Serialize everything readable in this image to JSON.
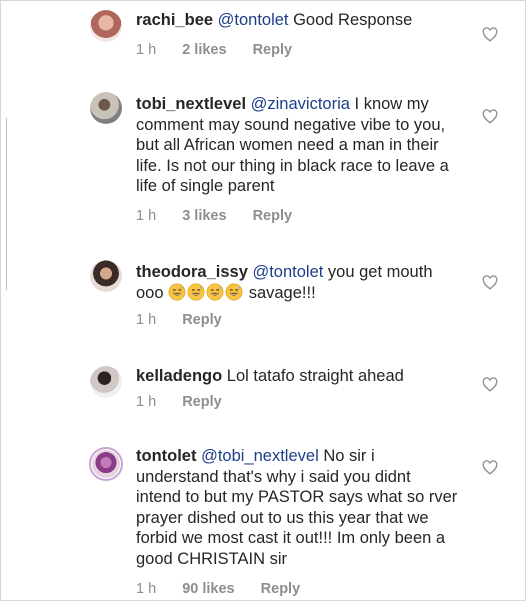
{
  "comments": [
    {
      "username": "rachi_bee",
      "mention": "@tontolet",
      "text": " Good Response",
      "time": "1 h",
      "likes": "2 likes",
      "reply": "Reply"
    },
    {
      "username": "tobi_nextlevel",
      "mention": "@zinavictoria",
      "text": " I know my comment may sound negative vibe to you, but all African women need a man in their life. Is not our thing in black race to leave a life of single parent",
      "time": "1 h",
      "likes": "3 likes",
      "reply": "Reply"
    },
    {
      "username": "theodora_issy",
      "mention": "@tontolet",
      "text_before": " you get mouth ooo ",
      "text_after": " savage!!!",
      "emoji": "grinning-sweat-face",
      "emoji_count": 4,
      "time": "1 h",
      "reply": "Reply"
    },
    {
      "username": "kelladengo",
      "text": " Lol tatafo straight ahead",
      "time": "1 h",
      "reply": "Reply"
    },
    {
      "username": "tontolet",
      "mention": "@tobi_nextlevel",
      "text": " No sir i understand that's why i said you didnt intend to but my PASTOR says what so rver prayer dished out to us this year that we forbid we most cast it out!!! Im only been a good CHRISTAIN sir",
      "time": "1 h",
      "likes": "90 likes",
      "reply": "Reply"
    }
  ],
  "icons": {
    "like": "heart-outline-icon"
  },
  "colors": {
    "mention": "#1d3f8a",
    "meta": "#8e8e8e",
    "text": "#262626",
    "story_ring": "#c7a4d6"
  }
}
